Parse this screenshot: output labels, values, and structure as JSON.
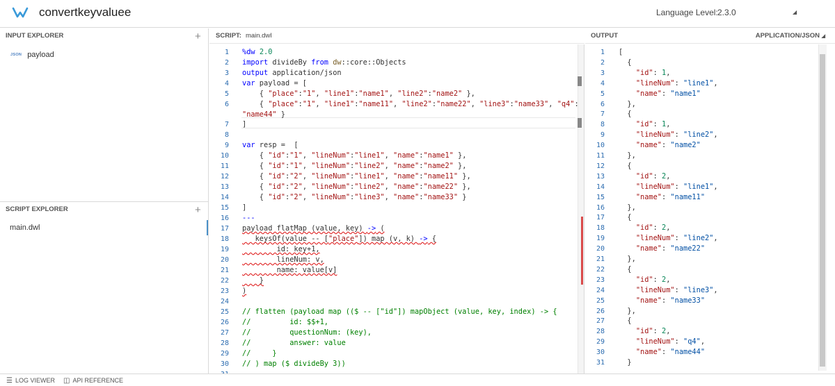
{
  "app": {
    "title": "convertkeyvaluee",
    "language_level_label": "Language Level:",
    "language_level_value": "2.3.0"
  },
  "input_explorer": {
    "title": "INPUT EXPLORER",
    "items": [
      {
        "badge": "JSON",
        "name": "payload"
      }
    ]
  },
  "script_explorer": {
    "title": "SCRIPT EXPLORER",
    "items": [
      {
        "name": "main.dwl"
      }
    ]
  },
  "script": {
    "title": "SCRIPT:",
    "filename": "main.dwl",
    "line_numbers": [
      "1",
      "2",
      "3",
      "4",
      "5",
      "6",
      "",
      "7",
      "8",
      "9",
      "10",
      "11",
      "12",
      "13",
      "14",
      "15",
      "16",
      "17",
      "18",
      "19",
      "20",
      "21",
      "22",
      "23",
      "24",
      "25",
      "26",
      "27",
      "28",
      "29",
      "30",
      "31"
    ]
  },
  "output": {
    "title": "OUTPUT",
    "mime": "APPLICATION/JSON",
    "line_numbers": [
      "1",
      "2",
      "3",
      "4",
      "5",
      "6",
      "7",
      "8",
      "9",
      "10",
      "11",
      "12",
      "13",
      "14",
      "15",
      "16",
      "17",
      "18",
      "19",
      "20",
      "21",
      "22",
      "23",
      "24",
      "25",
      "26",
      "27",
      "28",
      "29",
      "30",
      "31"
    ],
    "records": [
      {
        "id": "1",
        "lineNum": "\"line1\"",
        "name": "\"name1\""
      },
      {
        "id": "1",
        "lineNum": "\"line2\"",
        "name": "\"name2\""
      },
      {
        "id": "2",
        "lineNum": "\"line1\"",
        "name": "\"name11\""
      },
      {
        "id": "2",
        "lineNum": "\"line2\"",
        "name": "\"name22\""
      },
      {
        "id": "2",
        "lineNum": "\"line3\"",
        "name": "\"name33\""
      },
      {
        "id": "2",
        "lineNum": "\"q4\"",
        "name": "\"name44\""
      }
    ]
  },
  "footer": {
    "log_viewer": "LOG VIEWER",
    "api_reference": "API REFERENCE"
  },
  "colors": {
    "accent": "#4a90c8",
    "keyword": "#0000ff",
    "string": "#a31515",
    "comment": "#008000",
    "error": "#d94a4a"
  }
}
